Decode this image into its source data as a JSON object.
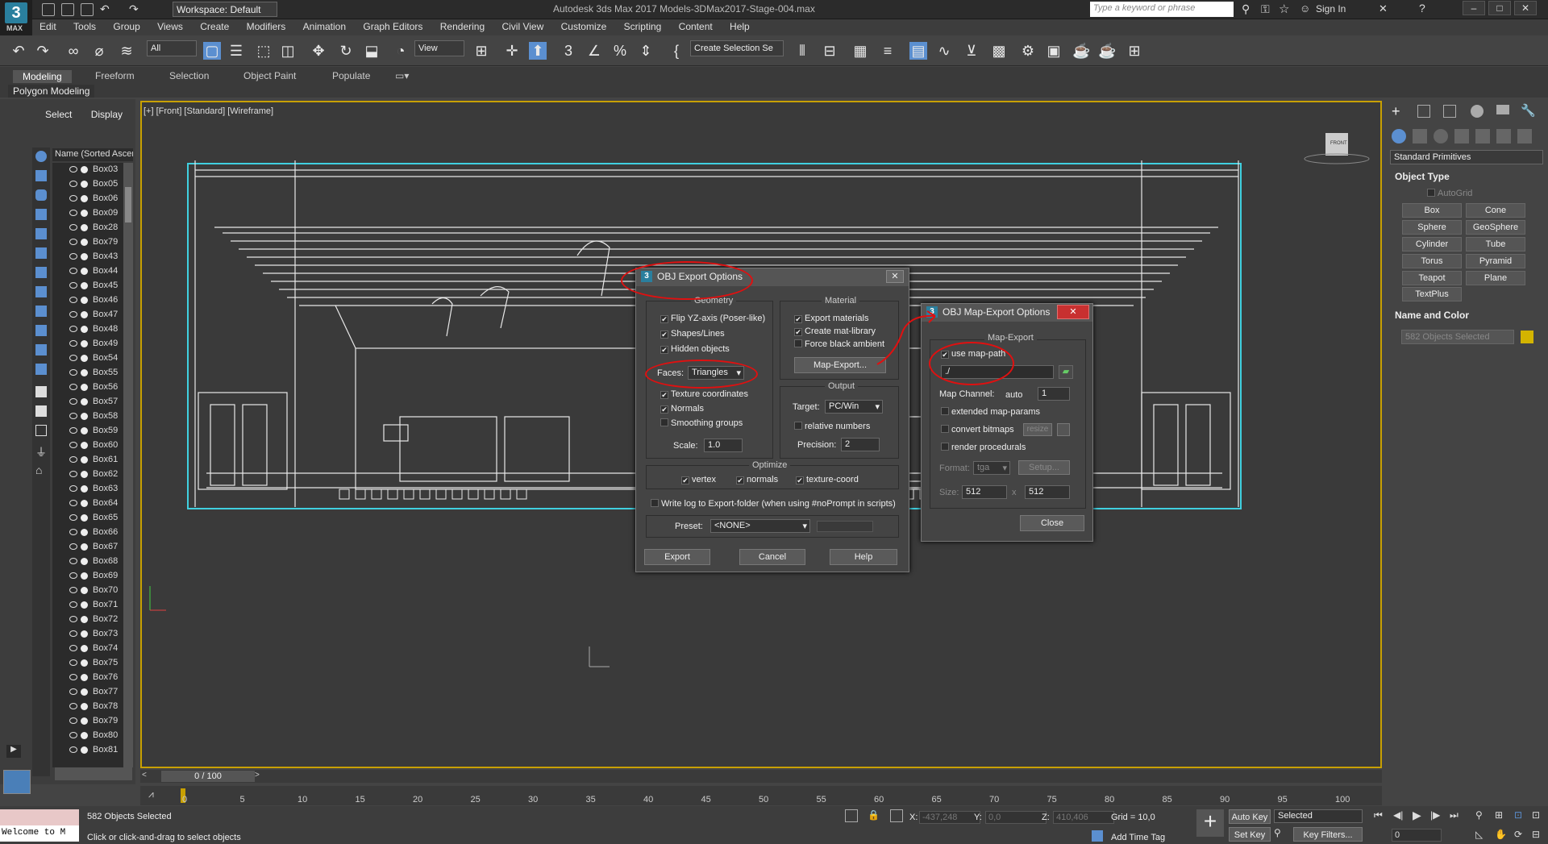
{
  "titlebar": {
    "workspace": "Workspace: Default",
    "title": "Autodesk 3ds Max 2017     Models-3DMax2017-Stage-004.max",
    "search_placeholder": "Type a keyword or phrase",
    "signin": "Sign In"
  },
  "app_logo": {
    "letter": "3",
    "label": "MAX"
  },
  "menu": [
    "Edit",
    "Tools",
    "Group",
    "Views",
    "Create",
    "Modifiers",
    "Animation",
    "Graph Editors",
    "Rendering",
    "Civil View",
    "Customize",
    "Scripting",
    "Content",
    "Help"
  ],
  "toolbar": {
    "filter": "All",
    "view": "View",
    "selection_set": "Create Selection Se"
  },
  "ribbon": {
    "tabs": [
      "Modeling",
      "Freeform",
      "Selection",
      "Object Paint",
      "Populate"
    ],
    "sub_label": "Polygon Modeling"
  },
  "scene_explorer": {
    "tabs": [
      "Select",
      "Display"
    ],
    "column_header": "Name (Sorted Ascer",
    "rows": [
      "Box03",
      "Box05",
      "Box06",
      "Box09",
      "Box28",
      "Box79",
      "Box43",
      "Box44",
      "Box45",
      "Box46",
      "Box47",
      "Box48",
      "Box49",
      "Box54",
      "Box55",
      "Box56",
      "Box57",
      "Box58",
      "Box59",
      "Box60",
      "Box61",
      "Box62",
      "Box63",
      "Box64",
      "Box65",
      "Box66",
      "Box67",
      "Box68",
      "Box69",
      "Box70",
      "Box71",
      "Box72",
      "Box73",
      "Box74",
      "Box75",
      "Box76",
      "Box77",
      "Box78",
      "Box79",
      "Box80",
      "Box81"
    ]
  },
  "viewport": {
    "label": "[+] [Front] [Standard] [Wireframe]",
    "viewcube": "FRONT"
  },
  "command_panel": {
    "category": "Standard Primitives",
    "object_type_title": "Object Type",
    "autogrid": "AutoGrid",
    "primitives": [
      "Box",
      "Cone",
      "Sphere",
      "GeoSphere",
      "Cylinder",
      "Tube",
      "Torus",
      "Pyramid",
      "Teapot",
      "Plane",
      "TextPlus"
    ],
    "name_color_title": "Name and Color",
    "name_field": "582 Objects Selected",
    "color": "#d4b400"
  },
  "timeline": {
    "frame": "0 / 100",
    "ticks": [
      "0",
      "5",
      "10",
      "15",
      "20",
      "25",
      "30",
      "35",
      "40",
      "45",
      "50",
      "55",
      "60",
      "65",
      "70",
      "75",
      "80",
      "85",
      "90",
      "95",
      "100"
    ]
  },
  "status": {
    "maxscript": "Welcome to M",
    "selected": "582 Objects Selected",
    "prompt": "Click or click-and-drag to select objects",
    "x_label": "X:",
    "x_value": "-437,248",
    "y_label": "Y:",
    "y_value": "0,0",
    "z_label": "Z:",
    "z_value": "410,406",
    "grid": "Grid = 10,0",
    "add_time_tag": "Add Time Tag",
    "auto_key": "Auto Key",
    "set_key": "Set Key",
    "selected_dd": "Selected",
    "key_filters": "Key Filters...",
    "frame_field": "0"
  },
  "obj_export": {
    "title": "OBJ Export Options",
    "geometry_title": "Geometry",
    "flip_yz": "Flip YZ-axis (Poser-like)",
    "shapes_lines": "Shapes/Lines",
    "hidden_objects": "Hidden objects",
    "faces_label": "Faces:",
    "faces_value": "Triangles",
    "texture_coords": "Texture coordinates",
    "normals": "Normals",
    "smoothing_groups": "Smoothing groups",
    "scale_label": "Scale:",
    "scale_value": "1.0",
    "material_title": "Material",
    "export_materials": "Export materials",
    "create_mat_library": "Create mat-library",
    "force_black_ambient": "Force black ambient",
    "map_export_btn": "Map-Export...",
    "output_title": "Output",
    "target_label": "Target:",
    "target_value": "PC/Win",
    "relative_numbers": "relative numbers",
    "precision_label": "Precision:",
    "precision_value": "2",
    "optimize_title": "Optimize",
    "opt_vertex": "vertex",
    "opt_normals": "normals",
    "opt_texture": "texture-coord",
    "write_log": "Write log to Export-folder (when using #noPrompt in scripts)",
    "preset_label": "Preset:",
    "preset_value": "<NONE>",
    "export_btn": "Export",
    "cancel_btn": "Cancel",
    "help_btn": "Help"
  },
  "map_export": {
    "title": "OBJ Map-Export Options",
    "group_title": "Map-Export",
    "use_map_path": "use map-path",
    "path_value": "./",
    "map_channel_label": "Map Channel:",
    "map_channel_mode": "auto",
    "map_channel_value": "1",
    "extended_map_params": "extended map-params",
    "convert_bitmaps": "convert bitmaps",
    "resize_btn": "resize",
    "render_procedurals": "render procedurals",
    "format_label": "Format:",
    "format_value": "tga",
    "setup_btn": "Setup...",
    "size_label": "Size:",
    "size_w": "512",
    "size_x": "x",
    "size_h": "512",
    "close_btn": "Close"
  }
}
